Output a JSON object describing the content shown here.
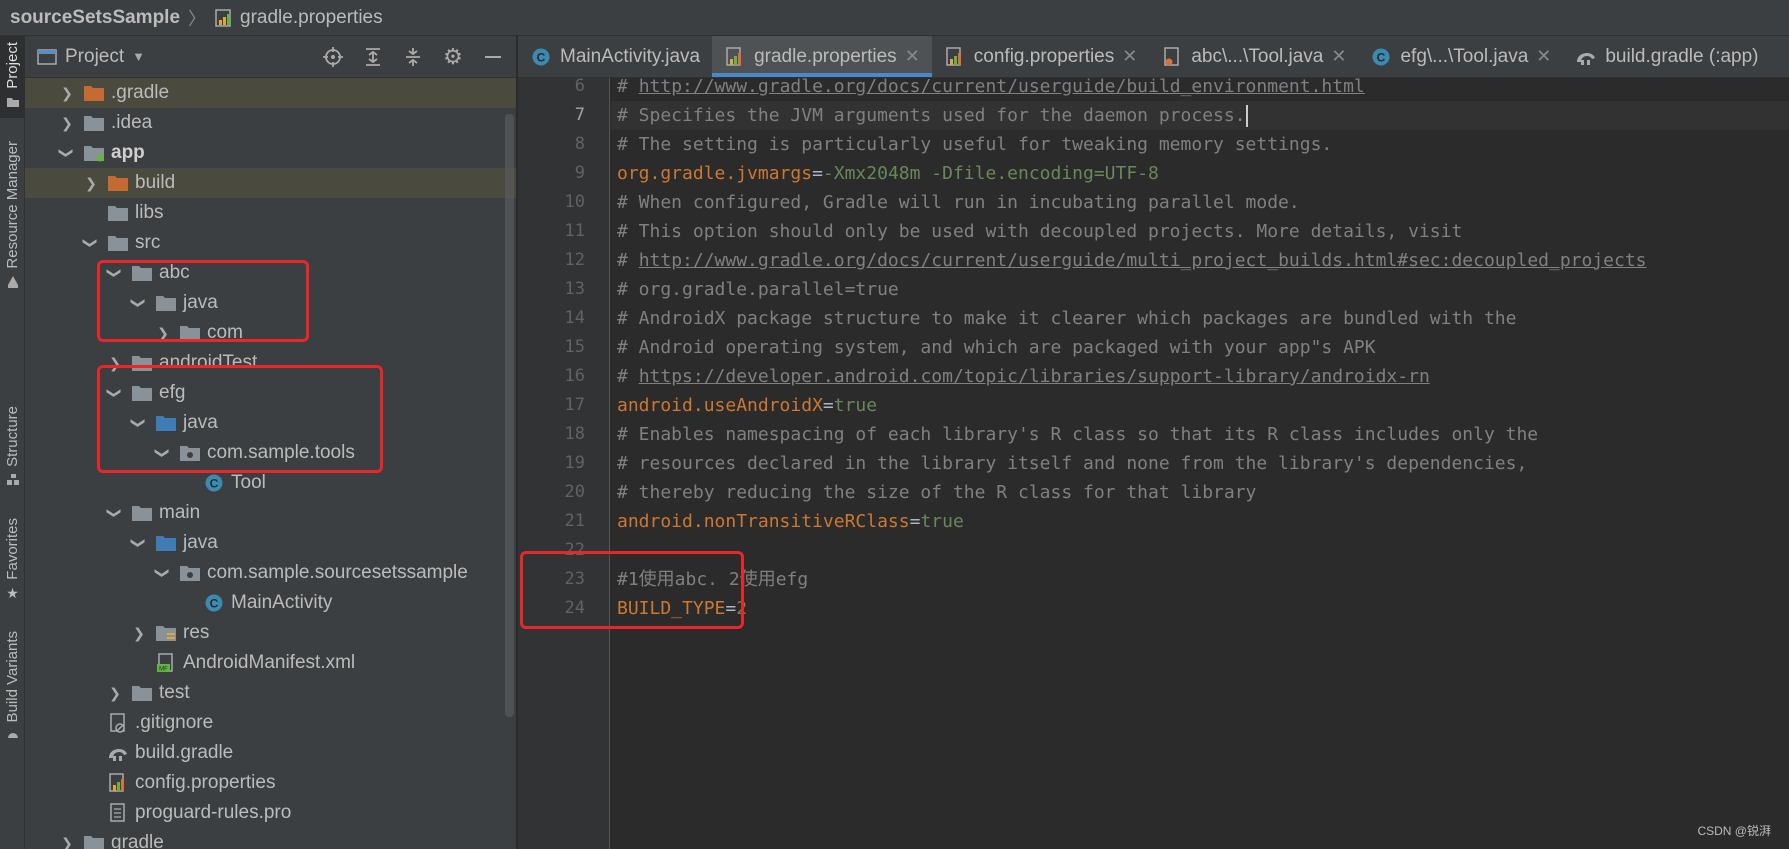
{
  "breadcrumb": {
    "project": "sourceSetsSample",
    "file": "gradle.properties"
  },
  "tool_strip": [
    "Project",
    "Resource Manager",
    "Structure",
    "Favorites",
    "Build Variants"
  ],
  "project_panel": {
    "title": "Project"
  },
  "tree": [
    {
      "label": ".gradle",
      "depth": 0,
      "arrow": "right",
      "icon": "folder-orange-icon",
      "excluded": true
    },
    {
      "label": ".idea",
      "depth": 0,
      "arrow": "right",
      "icon": "folder-icon"
    },
    {
      "label": "app",
      "depth": 0,
      "arrow": "down",
      "icon": "module-folder-icon",
      "bold": true
    },
    {
      "label": "build",
      "depth": 1,
      "arrow": "right",
      "icon": "folder-orange-icon",
      "excluded": true
    },
    {
      "label": "libs",
      "depth": 1,
      "arrow": "",
      "icon": "folder-icon"
    },
    {
      "label": "src",
      "depth": 1,
      "arrow": "down",
      "icon": "folder-icon"
    },
    {
      "label": "abc",
      "depth": 2,
      "arrow": "down",
      "icon": "folder-icon"
    },
    {
      "label": "java",
      "depth": 3,
      "arrow": "down",
      "icon": "folder-icon"
    },
    {
      "label": "com",
      "depth": 4,
      "arrow": "right",
      "icon": "folder-icon"
    },
    {
      "label": "androidTest",
      "depth": 2,
      "arrow": "right",
      "icon": "folder-icon"
    },
    {
      "label": "efg",
      "depth": 2,
      "arrow": "down",
      "icon": "folder-icon"
    },
    {
      "label": "java",
      "depth": 3,
      "arrow": "down",
      "icon": "folder-blue-icon"
    },
    {
      "label": "com.sample.tools",
      "depth": 4,
      "arrow": "down",
      "icon": "package-icon"
    },
    {
      "label": "Tool",
      "depth": 5,
      "arrow": "",
      "icon": "class-icon"
    },
    {
      "label": "main",
      "depth": 2,
      "arrow": "down",
      "icon": "folder-icon"
    },
    {
      "label": "java",
      "depth": 3,
      "arrow": "down",
      "icon": "folder-blue-icon"
    },
    {
      "label": "com.sample.sourcesetssample",
      "depth": 4,
      "arrow": "down",
      "icon": "package-icon"
    },
    {
      "label": "MainActivity",
      "depth": 5,
      "arrow": "",
      "icon": "class-icon"
    },
    {
      "label": "res",
      "depth": 3,
      "arrow": "right",
      "icon": "res-folder-icon"
    },
    {
      "label": "AndroidManifest.xml",
      "depth": 3,
      "arrow": "",
      "icon": "manifest-icon"
    },
    {
      "label": "test",
      "depth": 2,
      "arrow": "right",
      "icon": "folder-icon"
    },
    {
      "label": ".gitignore",
      "depth": 1,
      "arrow": "",
      "icon": "gitignore-icon"
    },
    {
      "label": "build.gradle",
      "depth": 1,
      "arrow": "",
      "icon": "gradle-icon"
    },
    {
      "label": "config.properties",
      "depth": 1,
      "arrow": "",
      "icon": "properties-icon"
    },
    {
      "label": "proguard-rules.pro",
      "depth": 1,
      "arrow": "",
      "icon": "text-file-icon"
    },
    {
      "label": "gradle",
      "depth": 0,
      "arrow": "right",
      "icon": "folder-icon"
    }
  ],
  "tabs": [
    {
      "label": "MainActivity.java",
      "icon": "class-icon",
      "closable": false
    },
    {
      "label": "gradle.properties",
      "icon": "properties-icon",
      "active": true,
      "closable": true
    },
    {
      "label": "config.properties",
      "icon": "properties-icon",
      "closable": true
    },
    {
      "label": "abc\\...\\Tool.java",
      "icon": "java-file-icon",
      "closable": true
    },
    {
      "label": "efg\\...\\Tool.java",
      "icon": "class-icon",
      "closable": true
    },
    {
      "label": "build.gradle (:app)",
      "icon": "gradle-icon",
      "closable": false
    }
  ],
  "editor": {
    "current_line": 7,
    "lines": [
      {
        "no": "6",
        "segs": [
          {
            "t": "# ",
            "c": "comment"
          },
          {
            "t": "http://www.gradle.org/docs/current/userguide/build_environment.html",
            "c": "link"
          }
        ]
      },
      {
        "no": "7",
        "segs": [
          {
            "t": "# Specifies the JVM arguments used for the daemon process.",
            "c": "comment"
          }
        ],
        "caret": true
      },
      {
        "no": "8",
        "segs": [
          {
            "t": "# The setting is particularly useful for tweaking memory settings.",
            "c": "comment"
          }
        ]
      },
      {
        "no": "9",
        "segs": [
          {
            "t": "org.gradle.jvmargs",
            "c": "key"
          },
          {
            "t": "=",
            "c": "eq"
          },
          {
            "t": "-Xmx2048m -Dfile.encoding=UTF-8",
            "c": "val"
          }
        ]
      },
      {
        "no": "10",
        "segs": [
          {
            "t": "# When configured, Gradle will run in incubating parallel mode.",
            "c": "comment"
          }
        ]
      },
      {
        "no": "11",
        "segs": [
          {
            "t": "# This option should only be used with decoupled projects. More details, visit",
            "c": "comment"
          }
        ]
      },
      {
        "no": "12",
        "segs": [
          {
            "t": "# ",
            "c": "comment"
          },
          {
            "t": "http://www.gradle.org/docs/current/userguide/multi_project_builds.html#sec:decoupled_projects",
            "c": "link"
          }
        ]
      },
      {
        "no": "13",
        "segs": [
          {
            "t": "# org.gradle.parallel=true",
            "c": "comment"
          }
        ]
      },
      {
        "no": "14",
        "segs": [
          {
            "t": "# AndroidX package structure to make it clearer which packages are bundled with the",
            "c": "comment"
          }
        ]
      },
      {
        "no": "15",
        "segs": [
          {
            "t": "# Android operating system, and which are packaged with your app\"s APK",
            "c": "comment"
          }
        ]
      },
      {
        "no": "16",
        "segs": [
          {
            "t": "# ",
            "c": "comment"
          },
          {
            "t": "https://developer.android.com/topic/libraries/support-library/androidx-rn",
            "c": "link"
          }
        ]
      },
      {
        "no": "17",
        "segs": [
          {
            "t": "android.useAndroidX",
            "c": "key"
          },
          {
            "t": "=",
            "c": "eq"
          },
          {
            "t": "true",
            "c": "val"
          }
        ]
      },
      {
        "no": "18",
        "segs": [
          {
            "t": "# Enables namespacing of each library's R class so that its R class includes only the",
            "c": "comment"
          }
        ]
      },
      {
        "no": "19",
        "segs": [
          {
            "t": "# resources declared in the library itself and none from the library's dependencies,",
            "c": "comment"
          }
        ]
      },
      {
        "no": "20",
        "segs": [
          {
            "t": "# thereby reducing the size of the R class for that library",
            "c": "comment"
          }
        ]
      },
      {
        "no": "21",
        "segs": [
          {
            "t": "android.nonTransitiveRClass",
            "c": "key"
          },
          {
            "t": "=",
            "c": "eq"
          },
          {
            "t": "true",
            "c": "val"
          }
        ]
      },
      {
        "no": "22",
        "segs": []
      },
      {
        "no": "23",
        "segs": [
          {
            "t": "#1使用abc. 2使用efg",
            "c": "comment"
          }
        ]
      },
      {
        "no": "24",
        "segs": [
          {
            "t": "BUILD_TYPE",
            "c": "key"
          },
          {
            "t": "=",
            "c": "eq"
          },
          {
            "t": "2",
            "c": "val"
          }
        ]
      }
    ]
  },
  "watermark": "CSDN @锐湃",
  "colors": {
    "annotation": "#e8272a",
    "tab_underline": "#4a88c7",
    "key": "#cc7832",
    "value": "#6a8759",
    "comment": "#808080"
  }
}
